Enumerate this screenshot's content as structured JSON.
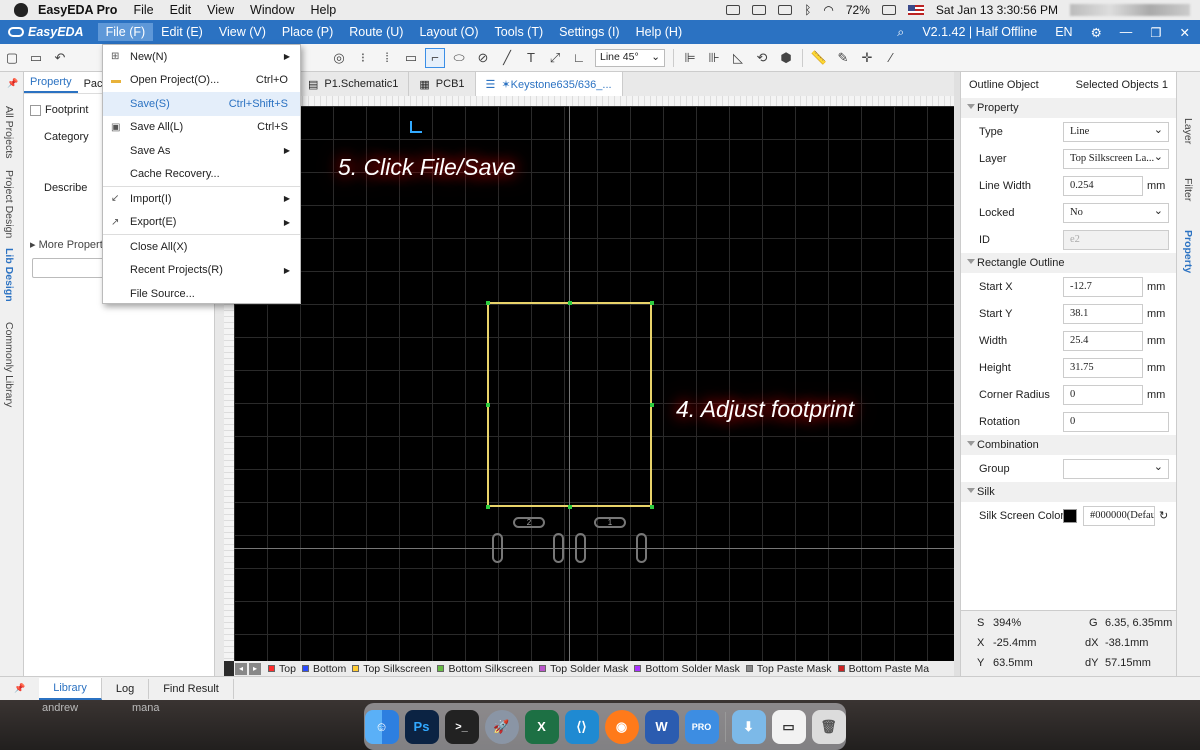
{
  "mac_menu": {
    "app_name": "EasyEDA Pro",
    "items": [
      "File",
      "Edit",
      "View",
      "Window",
      "Help"
    ],
    "battery": "72%",
    "datetime": "Sat Jan 13  3:30:56 PM"
  },
  "app_menu": {
    "logo": "EasyEDA",
    "items": [
      "File (F)",
      "Edit (E)",
      "View (V)",
      "Place (P)",
      "Route (U)",
      "Layout (O)",
      "Tools (T)",
      "Settings (I)",
      "Help (H)"
    ],
    "version": "V2.1.42 | Half Offline",
    "lang": "EN"
  },
  "toolbar": {
    "line_mode": "Line 45°"
  },
  "left_tabs": [
    "All Projects",
    "Project Design",
    "Lib Design",
    "Commonly Library"
  ],
  "left_panel": {
    "tabs": [
      "Property",
      "Pac"
    ],
    "footprint_label": "Footprint",
    "category_label": "Category",
    "describe_label": "Describe",
    "more_properties": "More Properti"
  },
  "doc_tabs": [
    "P1.Schematic1",
    "PCB1",
    "✶Keystone635/636_..."
  ],
  "annotations": {
    "step4": "4. Adjust footprint",
    "step5": "5. Click File/Save"
  },
  "pads": {
    "p1": "2",
    "p2": "1"
  },
  "layers": [
    {
      "name": "Top",
      "color": "#ff2b2b"
    },
    {
      "name": "Bottom",
      "color": "#2b4bff"
    },
    {
      "name": "Top Silkscreen",
      "color": "#ffcc33"
    },
    {
      "name": "Bottom Silkscreen",
      "color": "#66bb44"
    },
    {
      "name": "Top Solder Mask",
      "color": "#bb55cc"
    },
    {
      "name": "Bottom Solder Mask",
      "color": "#aa33ff"
    },
    {
      "name": "Top Paste Mask",
      "color": "#888888"
    },
    {
      "name": "Bottom Paste Ma",
      "color": "#cc2222"
    }
  ],
  "file_menu": [
    {
      "label": "New(N)",
      "shortcut": "",
      "submenu": true,
      "icon": "new-icon"
    },
    {
      "label": "Open Project(O)...",
      "shortcut": "Ctrl+O",
      "submenu": false,
      "icon": "folder-icon"
    },
    {
      "label": "Save(S)",
      "shortcut": "Ctrl+Shift+S",
      "submenu": false,
      "icon": ""
    },
    {
      "label": "Save All(L)",
      "shortcut": "Ctrl+S",
      "submenu": false,
      "icon": "save-all-icon"
    },
    {
      "label": "Save As",
      "shortcut": "",
      "submenu": true,
      "icon": ""
    },
    {
      "label": "Cache Recovery...",
      "shortcut": "",
      "submenu": false,
      "icon": ""
    },
    {
      "label": "Import(I)",
      "shortcut": "",
      "submenu": true,
      "icon": "import-icon"
    },
    {
      "label": "Export(E)",
      "shortcut": "",
      "submenu": true,
      "icon": "export-icon"
    },
    {
      "label": "Close All(X)",
      "shortcut": "",
      "submenu": false,
      "icon": ""
    },
    {
      "label": "Recent Projects(R)",
      "shortcut": "",
      "submenu": true,
      "icon": ""
    },
    {
      "label": "File Source...",
      "shortcut": "",
      "submenu": false,
      "icon": ""
    }
  ],
  "right_panel": {
    "header_left": "Outline Object",
    "header_right": "Selected Objects  1",
    "sections": {
      "property": "Property",
      "rectangle": "Rectangle Outline",
      "combination": "Combination",
      "silk": "Silk"
    },
    "fields": {
      "type": {
        "label": "Type",
        "value": "Line"
      },
      "layer": {
        "label": "Layer",
        "value": "Top Silkscreen La..."
      },
      "line_width": {
        "label": "Line Width",
        "value": "0.254",
        "unit": "mm"
      },
      "locked": {
        "label": "Locked",
        "value": "No"
      },
      "id": {
        "label": "ID",
        "value": "e2"
      },
      "start_x": {
        "label": "Start X",
        "value": "-12.7",
        "unit": "mm"
      },
      "start_y": {
        "label": "Start Y",
        "value": "38.1",
        "unit": "mm"
      },
      "width": {
        "label": "Width",
        "value": "25.4",
        "unit": "mm"
      },
      "height": {
        "label": "Height",
        "value": "31.75",
        "unit": "mm"
      },
      "corner_radius": {
        "label": "Corner Radius",
        "value": "0",
        "unit": "mm"
      },
      "rotation": {
        "label": "Rotation",
        "value": "0"
      },
      "group": {
        "label": "Group",
        "value": ""
      },
      "silk_color": {
        "label": "Silk Screen Color",
        "value": "#000000(Defau"
      }
    },
    "status": {
      "s": "S",
      "s_val": "394%",
      "g": "G",
      "g_val": "6.35, 6.35mm",
      "x": "X",
      "x_val": "-25.4mm",
      "dx": "dX",
      "dx_val": "-38.1mm",
      "y": "Y",
      "y_val": "63.5mm",
      "dy": "dY",
      "dy_val": "57.15mm"
    }
  },
  "right_tabs": [
    "Layer",
    "Filter",
    "Property"
  ],
  "bottom_tabs": [
    "Library",
    "Log",
    "Find Result"
  ],
  "desktop_labels": [
    "andrew",
    "mana"
  ],
  "dock_apps": [
    "Finder",
    "Ps",
    "Terminal",
    "Launchpad",
    "Excel",
    "VS Code",
    "Firefox",
    "Word",
    "EasyEDA Pro",
    "Downloads",
    "Preview",
    "Trash"
  ]
}
